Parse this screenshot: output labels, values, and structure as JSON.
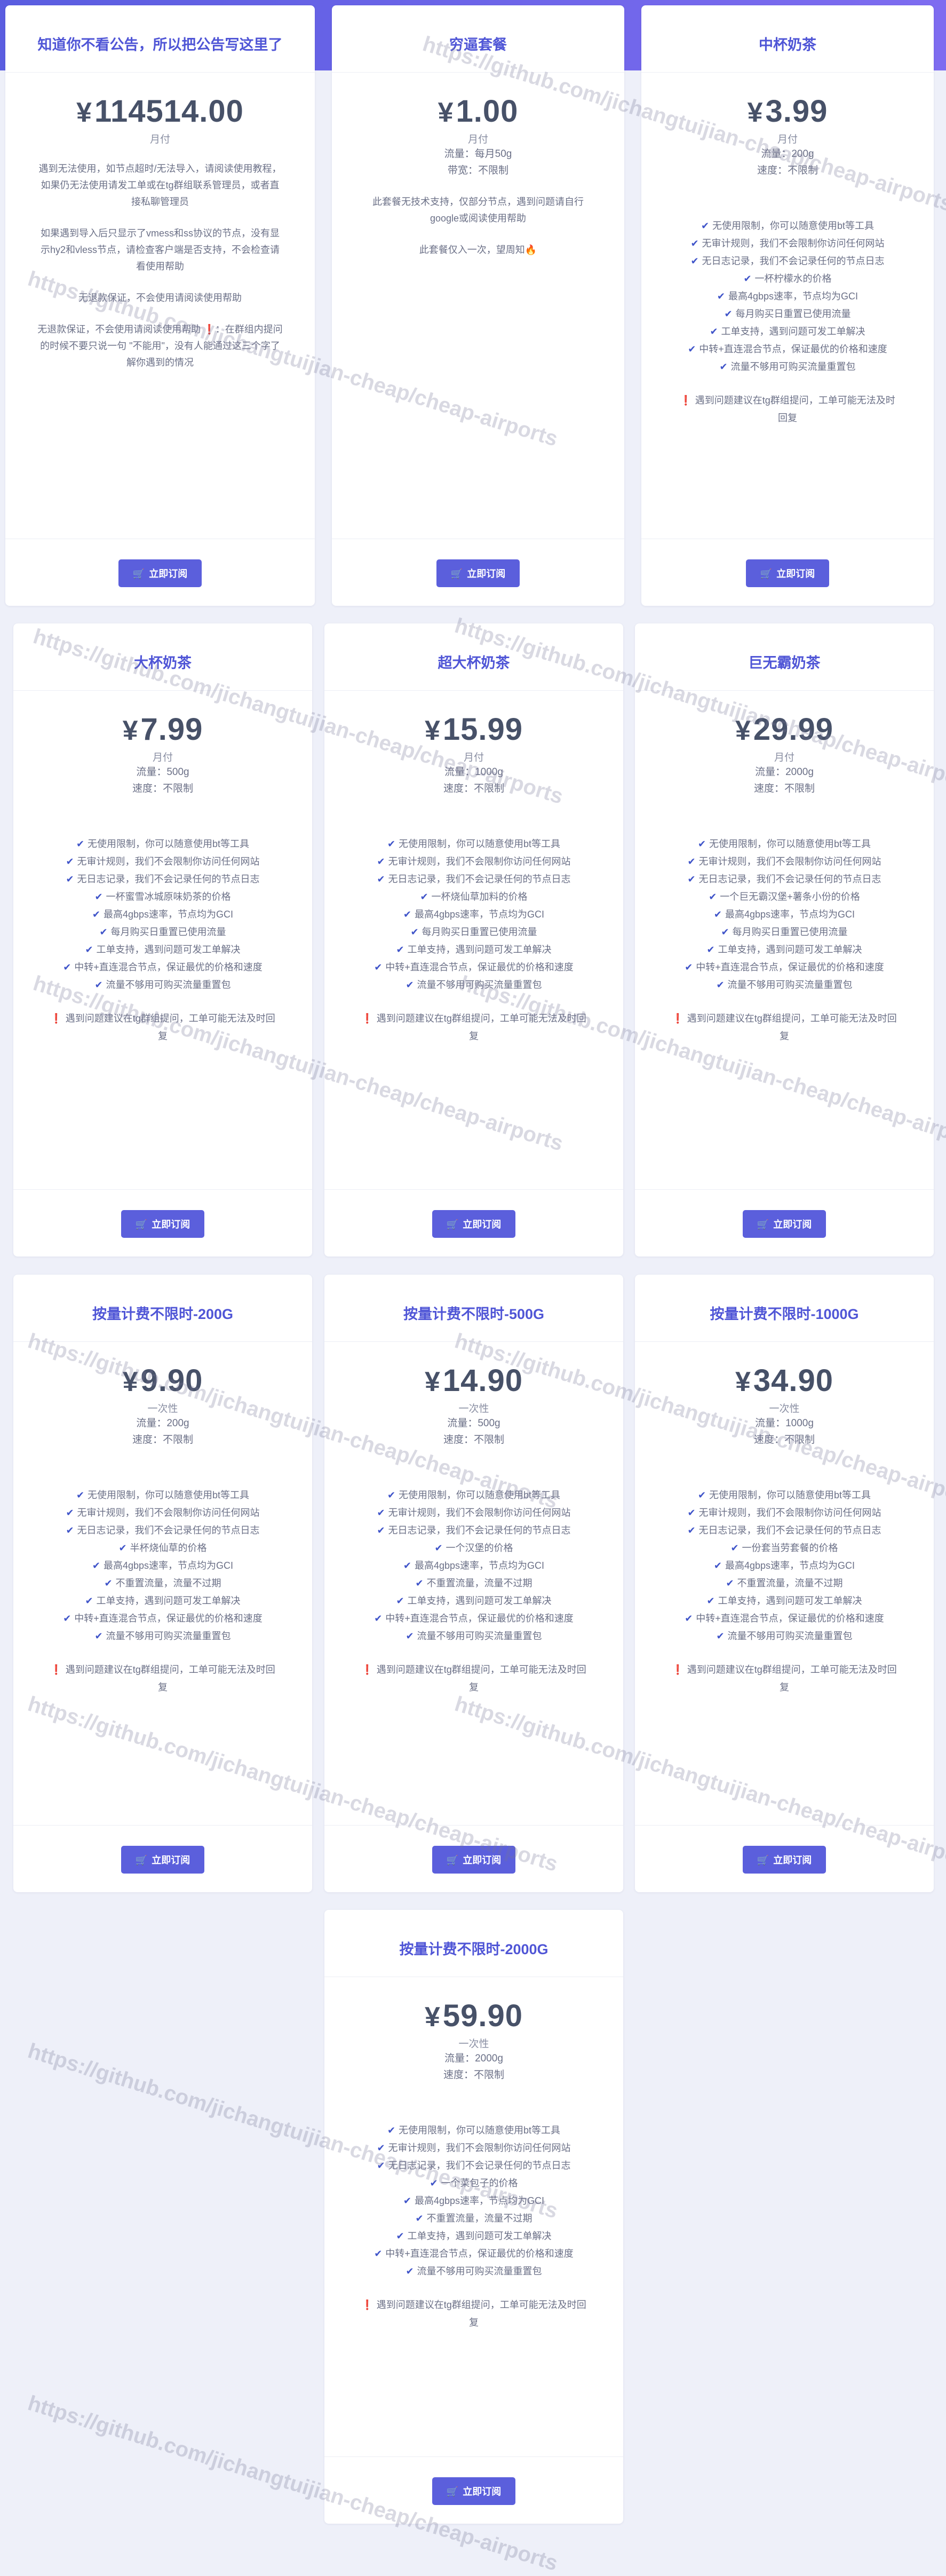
{
  "button_label": "立即订阅",
  "watermark": "https://github.com/jichangtuijian-cheap/cheap-airports",
  "cards": [
    {
      "title": "知道你不看公告，所以把公告写这里了",
      "currency": "¥",
      "price": "114514.00",
      "period": "月付",
      "meta": [],
      "desc": [
        "遇到无法使用，如节点超时/无法导入，请阅读使用教程，如果仍无法使用请发工单或在tg群组联系管理员，或者直接私聊管理员",
        "如果遇到导入后只显示了vmess和ss协议的节点，没有显示hy2和vless节点，请检查客户端是否支持，不会检查请看使用帮助",
        "无退款保证，不会使用请阅读使用帮助",
        "无退款保证，不会使用请阅读使用帮助 ❗：在群组内提问的时候不要只说一句 \"不能用\"，没有人能通过这三个字了解你遇到的情况"
      ],
      "features": [],
      "notes": []
    },
    {
      "title": "穷逼套餐",
      "currency": "¥",
      "price": "1.00",
      "period": "月付",
      "meta": [
        "流量：每月50g",
        "带宽：不限制"
      ],
      "desc": [
        "此套餐无技术支持，仅部分节点，遇到问题请自行google或阅读使用帮助",
        "此套餐仅入一次，望周知🔥"
      ],
      "features": [],
      "notes": []
    },
    {
      "title": "中杯奶茶",
      "currency": "¥",
      "price": "3.99",
      "period": "月付",
      "meta": [
        "流量：200g",
        "速度：不限制"
      ],
      "desc": [],
      "features": [
        "无使用限制，你可以随意使用bt等工具",
        "无审计规则，我们不会限制你访问任何网站",
        "无日志记录，我们不会记录任何的节点日志",
        "一杯柠檬水的价格",
        "最高4gbps速率，节点均为GCI",
        "每月购买日重置已使用流量",
        "工单支持，遇到问题可发工单解决",
        "中转+直连混合节点，保证最优的价格和速度",
        "流量不够用可购买流量重置包"
      ],
      "notes": [
        "遇到问题建议在tg群组提问，工单可能无法及时回复"
      ]
    },
    {
      "title": "大杯奶茶",
      "currency": "¥",
      "price": "7.99",
      "period": "月付",
      "meta": [
        "流量：500g",
        "速度：不限制"
      ],
      "desc": [],
      "features": [
        "无使用限制，你可以随意使用bt等工具",
        "无审计规则，我们不会限制你访问任何网站",
        "无日志记录，我们不会记录任何的节点日志",
        "一杯蜜雪冰城原味奶茶的价格",
        "最高4gbps速率，节点均为GCI",
        "每月购买日重置已使用流量",
        "工单支持，遇到问题可发工单解决",
        "中转+直连混合节点，保证最优的价格和速度",
        "流量不够用可购买流量重置包"
      ],
      "notes": [
        "遇到问题建议在tg群组提问，工单可能无法及时回复"
      ]
    },
    {
      "title": "超大杯奶茶",
      "currency": "¥",
      "price": "15.99",
      "period": "月付",
      "meta": [
        "流量：1000g",
        "速度：不限制"
      ],
      "desc": [],
      "features": [
        "无使用限制，你可以随意使用bt等工具",
        "无审计规则，我们不会限制你访问任何网站",
        "无日志记录，我们不会记录任何的节点日志",
        "一杯烧仙草加料的价格",
        "最高4gbps速率，节点均为GCI",
        "每月购买日重置已使用流量",
        "工单支持，遇到问题可发工单解决",
        "中转+直连混合节点，保证最优的价格和速度",
        "流量不够用可购买流量重置包"
      ],
      "notes": [
        "遇到问题建议在tg群组提问，工单可能无法及时回复"
      ]
    },
    {
      "title": "巨无霸奶茶",
      "currency": "¥",
      "price": "29.99",
      "period": "月付",
      "meta": [
        "流量：2000g",
        "速度：不限制"
      ],
      "desc": [],
      "features": [
        "无使用限制，你可以随意使用bt等工具",
        "无审计规则，我们不会限制你访问任何网站",
        "无日志记录，我们不会记录任何的节点日志",
        "一个巨无霸汉堡+薯条小份的价格",
        "最高4gbps速率，节点均为GCI",
        "每月购买日重置已使用流量",
        "工单支持，遇到问题可发工单解决",
        "中转+直连混合节点，保证最优的价格和速度",
        "流量不够用可购买流量重置包"
      ],
      "notes": [
        "遇到问题建议在tg群组提问，工单可能无法及时回复"
      ]
    },
    {
      "title": "按量计费不限时-200G",
      "currency": "¥",
      "price": "9.90",
      "period": "一次性",
      "meta": [
        "流量：200g",
        "速度：不限制"
      ],
      "desc": [],
      "features": [
        "无使用限制，你可以随意使用bt等工具",
        "无审计规则，我们不会限制你访问任何网站",
        "无日志记录，我们不会记录任何的节点日志",
        "半杯烧仙草的价格",
        "最高4gbps速率，节点均为GCI",
        "不重置流量，流量不过期",
        "工单支持，遇到问题可发工单解决",
        "中转+直连混合节点，保证最优的价格和速度",
        "流量不够用可购买流量重置包"
      ],
      "notes": [
        "遇到问题建议在tg群组提问，工单可能无法及时回复"
      ]
    },
    {
      "title": "按量计费不限时-500G",
      "currency": "¥",
      "price": "14.90",
      "period": "一次性",
      "meta": [
        "流量：500g",
        "速度：不限制"
      ],
      "desc": [],
      "features": [
        "无使用限制，你可以随意使用bt等工具",
        "无审计规则，我们不会限制你访问任何网站",
        "无日志记录，我们不会记录任何的节点日志",
        "一个汉堡的价格",
        "最高4gbps速率，节点均为GCI",
        "不重置流量，流量不过期",
        "工单支持，遇到问题可发工单解决",
        "中转+直连混合节点，保证最优的价格和速度",
        "流量不够用可购买流量重置包"
      ],
      "notes": [
        "遇到问题建议在tg群组提问，工单可能无法及时回复"
      ]
    },
    {
      "title": "按量计费不限时-1000G",
      "currency": "¥",
      "price": "34.90",
      "period": "一次性",
      "meta": [
        "流量：1000g",
        "速度：不限制"
      ],
      "desc": [],
      "features": [
        "无使用限制，你可以随意使用bt等工具",
        "无审计规则，我们不会限制你访问任何网站",
        "无日志记录，我们不会记录任何的节点日志",
        "一份套当劳套餐的价格",
        "最高4gbps速率，节点均为GCI",
        "不重置流量，流量不过期",
        "工单支持，遇到问题可发工单解决",
        "中转+直连混合节点，保证最优的价格和速度",
        "流量不够用可购买流量重置包"
      ],
      "notes": [
        "遇到问题建议在tg群组提问，工单可能无法及时回复"
      ]
    },
    {
      "title": "按量计费不限时-2000G",
      "currency": "¥",
      "price": "59.90",
      "period": "一次性",
      "meta": [
        "流量：2000g",
        "速度：不限制"
      ],
      "desc": [],
      "features": [
        "无使用限制，你可以随意使用bt等工具",
        "无审计规则，我们不会限制你访问任何网站",
        "无日志记录，我们不会记录任何的节点日志",
        "一个菜包子的价格",
        "最高4gbps速率，节点均为GCI",
        "不重置流量，流量不过期",
        "工单支持，遇到问题可发工单解决",
        "中转+直连混合节点，保证最优的价格和速度",
        "流量不够用可购买流量重置包"
      ],
      "notes": [
        "遇到问题建议在tg群组提问，工单可能无法及时回复"
      ]
    }
  ]
}
